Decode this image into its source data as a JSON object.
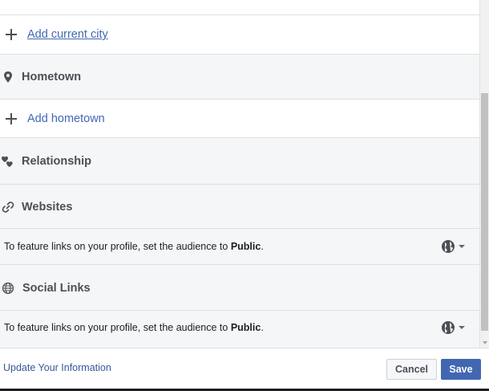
{
  "current_city": {
    "add_label": "Add current city"
  },
  "hometown": {
    "title": "Hometown",
    "add_label": "Add hometown"
  },
  "relationship": {
    "title": "Relationship"
  },
  "websites": {
    "title": "Websites",
    "note_prefix": "To feature links on your profile, set the audience to ",
    "note_emphasis": "Public",
    "note_suffix": "."
  },
  "social_links": {
    "title": "Social Links",
    "note_prefix": "To feature links on your profile, set the audience to ",
    "note_emphasis": "Public",
    "note_suffix": "."
  },
  "footer": {
    "update_link": "Update Your Information",
    "cancel_label": "Cancel",
    "save_label": "Save"
  },
  "icons": {
    "add": "plus-icon",
    "hometown": "map-pin-icon",
    "relationship": "hearts-icon",
    "websites": "link-icon",
    "social_links": "globe-grid-icon",
    "audience": "globe-icon"
  },
  "colors": {
    "link": "#4267b2",
    "save_button": "#4267b2",
    "section_bg": "#f5f6f7"
  }
}
